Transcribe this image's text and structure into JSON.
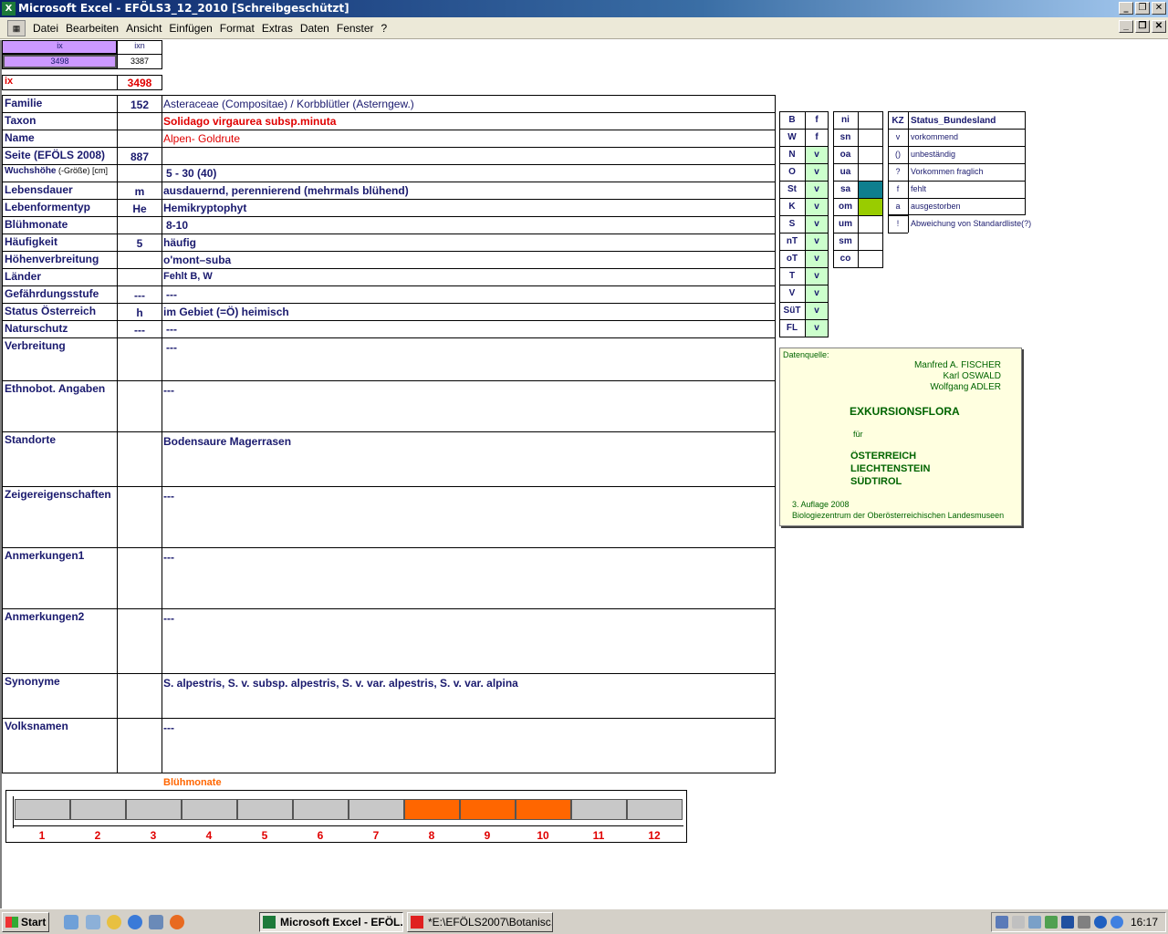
{
  "window": {
    "title": "Microsoft Excel - EFÖLS3_12_2010  [Schreibgeschützt]"
  },
  "menu": [
    "Datei",
    "Bearbeiten",
    "Ansicht",
    "Einfügen",
    "Format",
    "Extras",
    "Daten",
    "Fenster",
    "?"
  ],
  "index": {
    "ix_label": "ix",
    "ixn_label": "ixn",
    "ix_value": "3498",
    "ixn_value": "3387",
    "ix2_label": "ix",
    "ix2_value": "3498"
  },
  "rows": [
    {
      "label": "Familie",
      "code": "152",
      "value": "Asteraceae (Compositae)  /  Korbblütler (Asterngew.)"
    },
    {
      "label": "Taxon",
      "code": "",
      "value": "Solidago virgaurea subsp.minuta"
    },
    {
      "label": "Name",
      "code": "",
      "value": "Alpen- Goldrute"
    },
    {
      "label": "Seite (EFÖLS 2008)",
      "code": "887",
      "value": ""
    },
    {
      "label": "Wuchshöhe",
      "label_suffix": " (-Größe) [cm]",
      "code": "",
      "value": "5 - 30 (40)"
    },
    {
      "label": "Lebensdauer",
      "code": "m",
      "value": "ausdauernd, perennierend (mehrmals blühend)"
    },
    {
      "label": "Lebenformentyp",
      "code": "He",
      "value": "Hemikryptophyt"
    },
    {
      "label": "Blühmonate",
      "code": "",
      "value": "8-10"
    },
    {
      "label": "Häufigkeit",
      "code": "5",
      "value": "häufig"
    },
    {
      "label": "Höhenverbreitung",
      "code": "",
      "value": "o'mont–suba"
    },
    {
      "label": "Länder",
      "code": "",
      "value": "Fehlt B, W"
    },
    {
      "label": "Gefährdungsstufe",
      "code": "---",
      "value": "---"
    },
    {
      "label": "Status Österreich",
      "code": "h",
      "value": "im Gebiet (=Ö) heimisch"
    },
    {
      "label": "Naturschutz",
      "code": "---",
      "value": "---"
    },
    {
      "label": "Verbreitung",
      "code": "",
      "value": "---"
    },
    {
      "label": "Ethnobot. Angaben",
      "code": "",
      "value": "---"
    },
    {
      "label": "Standorte",
      "code": "",
      "value": "Bodensaure Magerrasen"
    },
    {
      "label": "Zeigereigenschaften",
      "code": "",
      "value": "---"
    },
    {
      "label": "Anmerkungen1",
      "code": "",
      "value": "---"
    },
    {
      "label": "Anmerkungen2",
      "code": "",
      "value": "---"
    },
    {
      "label": "Synonyme",
      "code": "",
      "value": "S. alpestris, S. v. subsp. alpestris, S. v. var. alpestris, S. v. var. alpina"
    },
    {
      "label": "Volksnamen",
      "code": "",
      "value": "---"
    }
  ],
  "bundesland": [
    {
      "k": "B",
      "v": "f"
    },
    {
      "k": "W",
      "v": "f"
    },
    {
      "k": "N",
      "v": "v"
    },
    {
      "k": "O",
      "v": "v"
    },
    {
      "k": "St",
      "v": "v"
    },
    {
      "k": "K",
      "v": "v"
    },
    {
      "k": "S",
      "v": "v"
    },
    {
      "k": "nT",
      "v": "v"
    },
    {
      "k": "oT",
      "v": "v"
    },
    {
      "k": "T",
      "v": "v"
    },
    {
      "k": "V",
      "v": "v"
    },
    {
      "k": "SüT",
      "v": "v"
    },
    {
      "k": "FL",
      "v": "v"
    }
  ],
  "hoehen": [
    "ni",
    "sn",
    "oa",
    "ua",
    "sa",
    "om",
    "um",
    "sm",
    "co"
  ],
  "hoehen_colors": {
    "sa": "#0e7e8e",
    "om": "#99cc00"
  },
  "legend": {
    "header_kz": "KZ",
    "header_status": "Status_Bundesland",
    "items": [
      {
        "k": "v",
        "t": "vorkommend"
      },
      {
        "k": "()",
        "t": "unbeständig"
      },
      {
        "k": "?",
        "t": "Vorkommen fraglich"
      },
      {
        "k": "f",
        "t": "fehlt"
      },
      {
        "k": "a",
        "t": "ausgestorben"
      },
      {
        "k": "!",
        "t": "Abweichung von Standardliste(?)"
      }
    ]
  },
  "datasource": {
    "label": "Datenquelle:",
    "authors": [
      "Manfred A. FISCHER",
      "Karl OSWALD",
      "Wolfgang ADLER"
    ],
    "title": "EXKURSIONSFLORA",
    "fuer": "für",
    "countries": [
      "ÖSTERREICH",
      "LIECHTENSTEIN",
      "SÜDTIROL"
    ],
    "edition": "3. Auflage 2008",
    "publisher": "Biologiezentrum der Oberösterreichischen Landesmuseen"
  },
  "months_chart": {
    "title": "Blühmonate",
    "months": [
      "1",
      "2",
      "3",
      "4",
      "5",
      "6",
      "7",
      "8",
      "9",
      "10",
      "11",
      "12"
    ],
    "flowering": [
      8,
      9,
      10
    ],
    "color_on": "#ff6600",
    "color_off": "#c8c8c8"
  },
  "taskbar": {
    "start": "Start",
    "tasks": [
      {
        "label": "Microsoft Excel - EFÖL...",
        "active": true
      },
      {
        "label": "*E:\\EFÖLS2007\\Botanisc...",
        "active": false
      }
    ],
    "clock": "16:17"
  }
}
